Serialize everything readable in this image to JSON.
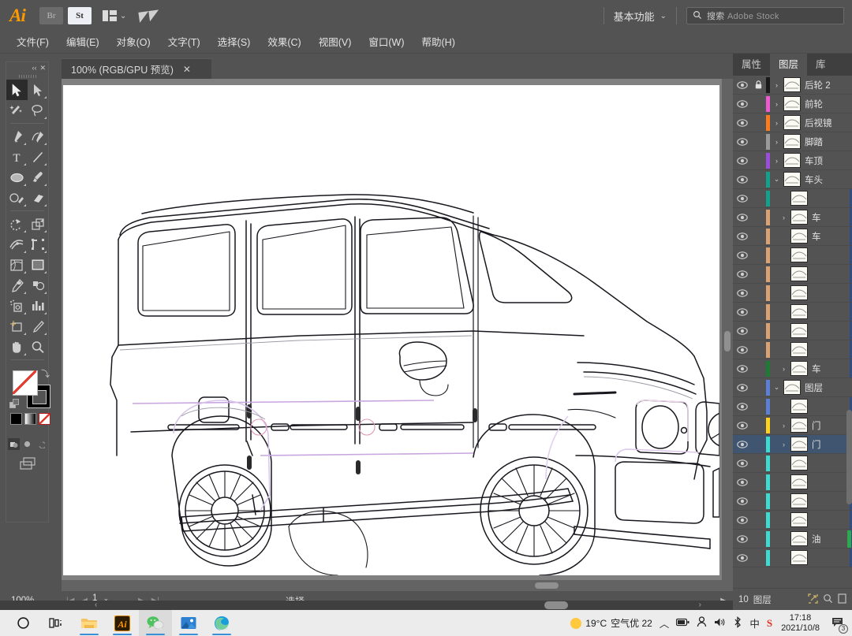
{
  "app": {
    "name": "Adobe Illustrator",
    "logo_text": "Ai",
    "logo_color": "#ff9a00",
    "bridge_label": "Br",
    "stock_label": "St"
  },
  "topbar": {
    "workspace_label": "基本功能",
    "workspace_chevron": "chevron-down-icon",
    "search_placeholder_cn": "搜索",
    "search_placeholder_en": "Adobe Stock"
  },
  "menu": {
    "items": [
      {
        "label": "文件(F)"
      },
      {
        "label": "编辑(E)"
      },
      {
        "label": "对象(O)"
      },
      {
        "label": "文字(T)"
      },
      {
        "label": "选择(S)"
      },
      {
        "label": "效果(C)"
      },
      {
        "label": "视图(V)"
      },
      {
        "label": "窗口(W)"
      },
      {
        "label": "帮助(H)"
      }
    ]
  },
  "document_tab": {
    "title": "100% (RGB/GPU 预览)",
    "close_label": "✕"
  },
  "toolbar": {
    "collapse_label": "‹‹",
    "close_label": "✕",
    "tools": [
      {
        "name": "selection-tool",
        "selected": true
      },
      {
        "name": "direct-selection-tool",
        "selected": false
      },
      {
        "name": "magic-wand-tool",
        "selected": false
      },
      {
        "name": "lasso-tool",
        "selected": false
      },
      {
        "name": "pen-tool",
        "selected": false
      },
      {
        "name": "curvature-tool",
        "selected": false
      },
      {
        "name": "type-tool",
        "selected": false
      },
      {
        "name": "line-segment-tool",
        "selected": false
      },
      {
        "name": "ellipse-tool",
        "selected": false
      },
      {
        "name": "paintbrush-tool",
        "selected": false
      },
      {
        "name": "shaper-tool",
        "selected": false
      },
      {
        "name": "eraser-tool",
        "selected": false
      },
      {
        "name": "rotate-tool",
        "selected": false
      },
      {
        "name": "scale-tool",
        "selected": false
      },
      {
        "name": "width-tool",
        "selected": false
      },
      {
        "name": "free-transform-tool",
        "selected": false
      },
      {
        "name": "shape-builder-tool",
        "selected": false
      },
      {
        "name": "perspective-grid-tool",
        "selected": false
      },
      {
        "name": "mesh-tool",
        "selected": false
      },
      {
        "name": "gradient-tool",
        "selected": false
      },
      {
        "name": "eyedropper-tool",
        "selected": false
      },
      {
        "name": "blend-tool",
        "selected": false
      },
      {
        "name": "symbol-sprayer-tool",
        "selected": false
      },
      {
        "name": "column-graph-tool",
        "selected": false
      },
      {
        "name": "artboard-tool",
        "selected": false
      },
      {
        "name": "slice-tool",
        "selected": false
      },
      {
        "name": "hand-tool",
        "selected": false
      },
      {
        "name": "zoom-tool",
        "selected": false
      }
    ],
    "fill_color": "#ffffff",
    "stroke_color": "#000000",
    "fill_is_none": true,
    "color_modes": [
      {
        "name": "color-mode",
        "color": "#000000"
      },
      {
        "name": "gradient-mode",
        "color": "#808080"
      },
      {
        "name": "none-mode",
        "color": "#ffffff"
      }
    ],
    "draw_modes": [
      {
        "name": "draw-normal",
        "active": true
      },
      {
        "name": "draw-behind",
        "active": false
      },
      {
        "name": "draw-inside",
        "active": false
      }
    ],
    "screen_mode": "screen-mode-icon"
  },
  "statusbar": {
    "zoom_value": "100%",
    "page_value": "1",
    "status_text": "选择",
    "first_label": "|◀",
    "prev_label": "◀",
    "next_label": "▶",
    "last_label": "▶|"
  },
  "right_panel": {
    "tabs": [
      {
        "label": "属性",
        "active": false
      },
      {
        "label": "图层",
        "active": true
      },
      {
        "label": "库",
        "active": false
      }
    ],
    "footer": {
      "count_text": "10",
      "count_label": "图层",
      "locate_icon": "locate-object-icon",
      "search_icon": "search-icon",
      "new_sublayer_icon": "new-sublayer-icon"
    },
    "layers": [
      {
        "name": "后轮 2",
        "color": "#1a1a1a",
        "locked": true,
        "has_children": true,
        "expanded": false,
        "indent": 0,
        "selected": false,
        "visible": true
      },
      {
        "name": "前轮",
        "color": "#f05ad0",
        "locked": false,
        "has_children": true,
        "expanded": false,
        "indent": 0,
        "selected": false,
        "visible": true
      },
      {
        "name": "后视镜",
        "color": "#ff7a1a",
        "locked": false,
        "has_children": true,
        "expanded": false,
        "indent": 0,
        "selected": false,
        "visible": true
      },
      {
        "name": "脚踏",
        "color": "#9a9a9a",
        "locked": false,
        "has_children": true,
        "expanded": false,
        "indent": 0,
        "selected": false,
        "visible": true
      },
      {
        "name": "车顶",
        "color": "#9b4ddb",
        "locked": false,
        "has_children": true,
        "expanded": false,
        "indent": 0,
        "selected": false,
        "visible": true
      },
      {
        "name": "车头",
        "color": "#12a18a",
        "locked": false,
        "has_children": true,
        "expanded": true,
        "indent": 0,
        "selected": false,
        "visible": true
      },
      {
        "name": "",
        "color": "#12a18a",
        "locked": false,
        "has_children": false,
        "expanded": false,
        "indent": 1,
        "selected": false,
        "visible": true
      },
      {
        "name": "车",
        "color": "#d9a273",
        "locked": false,
        "has_children": true,
        "expanded": false,
        "indent": 1,
        "selected": false,
        "visible": true
      },
      {
        "name": "车",
        "color": "#d9a273",
        "locked": false,
        "has_children": false,
        "expanded": false,
        "indent": 1,
        "selected": false,
        "visible": true
      },
      {
        "name": "",
        "color": "#d9a273",
        "locked": false,
        "has_children": false,
        "expanded": false,
        "indent": 1,
        "selected": false,
        "visible": true
      },
      {
        "name": "",
        "color": "#d9a273",
        "locked": false,
        "has_children": false,
        "expanded": false,
        "indent": 1,
        "selected": false,
        "visible": true
      },
      {
        "name": "",
        "color": "#d9a273",
        "locked": false,
        "has_children": false,
        "expanded": false,
        "indent": 1,
        "selected": false,
        "visible": true
      },
      {
        "name": "",
        "color": "#d9a273",
        "locked": false,
        "has_children": false,
        "expanded": false,
        "indent": 1,
        "selected": false,
        "visible": true
      },
      {
        "name": "",
        "color": "#d9a273",
        "locked": false,
        "has_children": false,
        "expanded": false,
        "indent": 1,
        "selected": false,
        "visible": true
      },
      {
        "name": "",
        "color": "#d9a273",
        "locked": false,
        "has_children": false,
        "expanded": false,
        "indent": 1,
        "selected": false,
        "visible": true
      },
      {
        "name": "车",
        "color": "#1f7a33",
        "locked": false,
        "has_children": true,
        "expanded": false,
        "indent": 1,
        "selected": false,
        "visible": true
      },
      {
        "name": "图层",
        "color": "#5b7fd4",
        "locked": false,
        "has_children": true,
        "expanded": true,
        "indent": 0,
        "selected": false,
        "visible": true
      },
      {
        "name": "",
        "color": "#5b7fd4",
        "locked": false,
        "has_children": false,
        "expanded": false,
        "indent": 1,
        "selected": false,
        "visible": true
      },
      {
        "name": "门",
        "color": "#ffd21e",
        "locked": false,
        "has_children": true,
        "expanded": false,
        "indent": 1,
        "selected": false,
        "visible": true
      },
      {
        "name": "门",
        "color": "#3edbd0",
        "locked": false,
        "has_children": true,
        "expanded": false,
        "indent": 1,
        "selected": true,
        "visible": true
      },
      {
        "name": "",
        "color": "#3edbd0",
        "locked": false,
        "has_children": false,
        "expanded": false,
        "indent": 1,
        "selected": false,
        "visible": true
      },
      {
        "name": "",
        "color": "#3edbd0",
        "locked": false,
        "has_children": false,
        "expanded": false,
        "indent": 1,
        "selected": false,
        "visible": true
      },
      {
        "name": "",
        "color": "#3edbd0",
        "locked": false,
        "has_children": false,
        "expanded": false,
        "indent": 1,
        "selected": false,
        "visible": true
      },
      {
        "name": "",
        "color": "#3edbd0",
        "locked": false,
        "has_children": false,
        "expanded": false,
        "indent": 1,
        "selected": false,
        "visible": true
      },
      {
        "name": "油",
        "color": "#3edbd0",
        "locked": false,
        "has_children": false,
        "expanded": false,
        "indent": 1,
        "selected": false,
        "visible": true
      },
      {
        "name": "",
        "color": "#3edbd0",
        "locked": false,
        "has_children": false,
        "expanded": false,
        "indent": 1,
        "selected": false,
        "visible": true
      }
    ]
  },
  "canvas": {
    "artwork_name": "mercedes-g-class-line-drawing",
    "background": "#ffffff",
    "canvas_background": "#808080"
  },
  "taskbar": {
    "items": [
      {
        "name": "start-button",
        "glyph": "◯",
        "running": false,
        "active": false
      },
      {
        "name": "task-view-button",
        "glyph": "",
        "running": false,
        "active": false
      },
      {
        "name": "file-explorer-button",
        "glyph": "",
        "running": true,
        "active": false
      },
      {
        "name": "illustrator-button",
        "glyph": "Ai",
        "running": true,
        "active": false
      },
      {
        "name": "wechat-button",
        "glyph": "",
        "running": true,
        "active": true
      },
      {
        "name": "photos-button",
        "glyph": "",
        "running": true,
        "active": false
      },
      {
        "name": "edge-button",
        "glyph": "",
        "running": true,
        "active": false
      }
    ],
    "weather_temp": "19°C",
    "weather_air": "空气优 22",
    "tray": {
      "expand": "︿",
      "battery": "battery-icon",
      "user": "user-icon",
      "volume": "volume-icon",
      "bluetooth": "bluetooth-icon",
      "ime": "中",
      "sogou": "S"
    },
    "clock_time": "17:18",
    "clock_date": "2021/10/8",
    "notification_count": "3"
  }
}
